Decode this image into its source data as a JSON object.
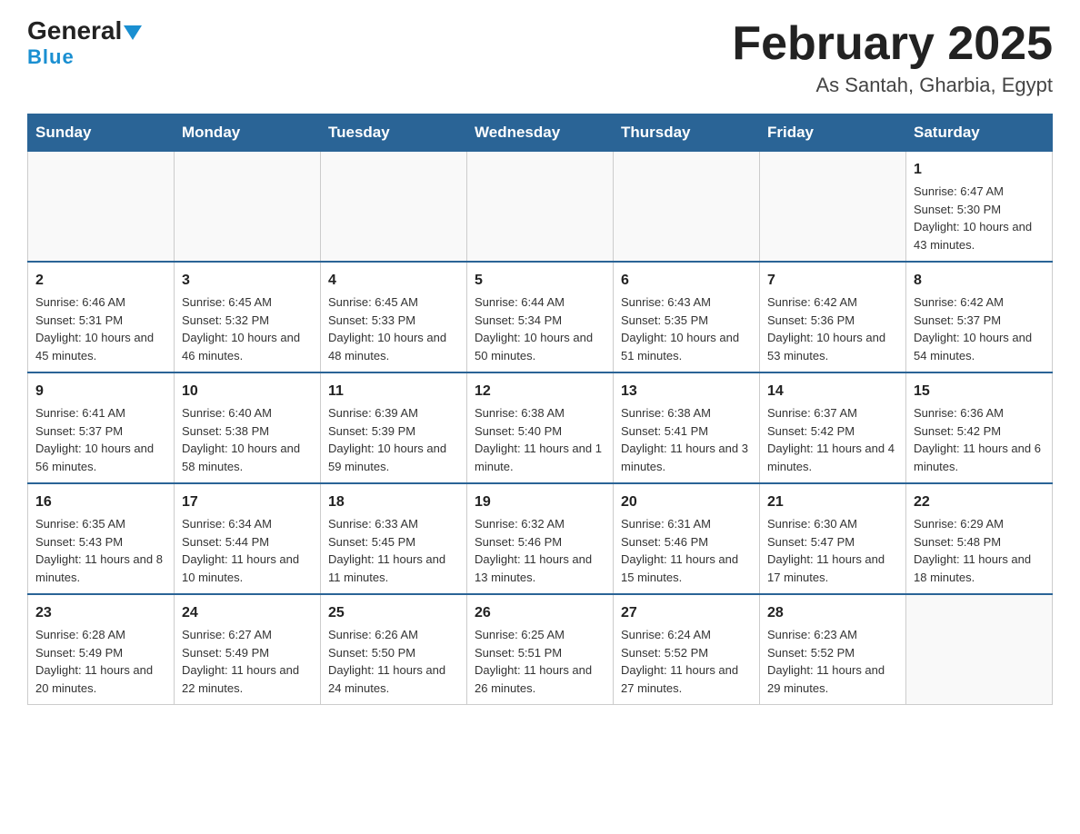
{
  "header": {
    "logo_main": "General",
    "logo_sub": "Blue",
    "title": "February 2025",
    "subtitle": "As Santah, Gharbia, Egypt"
  },
  "days_of_week": [
    "Sunday",
    "Monday",
    "Tuesday",
    "Wednesday",
    "Thursday",
    "Friday",
    "Saturday"
  ],
  "weeks": [
    [
      {
        "day": "",
        "sunrise": "",
        "sunset": "",
        "daylight": ""
      },
      {
        "day": "",
        "sunrise": "",
        "sunset": "",
        "daylight": ""
      },
      {
        "day": "",
        "sunrise": "",
        "sunset": "",
        "daylight": ""
      },
      {
        "day": "",
        "sunrise": "",
        "sunset": "",
        "daylight": ""
      },
      {
        "day": "",
        "sunrise": "",
        "sunset": "",
        "daylight": ""
      },
      {
        "day": "",
        "sunrise": "",
        "sunset": "",
        "daylight": ""
      },
      {
        "day": "1",
        "sunrise": "Sunrise: 6:47 AM",
        "sunset": "Sunset: 5:30 PM",
        "daylight": "Daylight: 10 hours and 43 minutes."
      }
    ],
    [
      {
        "day": "2",
        "sunrise": "Sunrise: 6:46 AM",
        "sunset": "Sunset: 5:31 PM",
        "daylight": "Daylight: 10 hours and 45 minutes."
      },
      {
        "day": "3",
        "sunrise": "Sunrise: 6:45 AM",
        "sunset": "Sunset: 5:32 PM",
        "daylight": "Daylight: 10 hours and 46 minutes."
      },
      {
        "day": "4",
        "sunrise": "Sunrise: 6:45 AM",
        "sunset": "Sunset: 5:33 PM",
        "daylight": "Daylight: 10 hours and 48 minutes."
      },
      {
        "day": "5",
        "sunrise": "Sunrise: 6:44 AM",
        "sunset": "Sunset: 5:34 PM",
        "daylight": "Daylight: 10 hours and 50 minutes."
      },
      {
        "day": "6",
        "sunrise": "Sunrise: 6:43 AM",
        "sunset": "Sunset: 5:35 PM",
        "daylight": "Daylight: 10 hours and 51 minutes."
      },
      {
        "day": "7",
        "sunrise": "Sunrise: 6:42 AM",
        "sunset": "Sunset: 5:36 PM",
        "daylight": "Daylight: 10 hours and 53 minutes."
      },
      {
        "day": "8",
        "sunrise": "Sunrise: 6:42 AM",
        "sunset": "Sunset: 5:37 PM",
        "daylight": "Daylight: 10 hours and 54 minutes."
      }
    ],
    [
      {
        "day": "9",
        "sunrise": "Sunrise: 6:41 AM",
        "sunset": "Sunset: 5:37 PM",
        "daylight": "Daylight: 10 hours and 56 minutes."
      },
      {
        "day": "10",
        "sunrise": "Sunrise: 6:40 AM",
        "sunset": "Sunset: 5:38 PM",
        "daylight": "Daylight: 10 hours and 58 minutes."
      },
      {
        "day": "11",
        "sunrise": "Sunrise: 6:39 AM",
        "sunset": "Sunset: 5:39 PM",
        "daylight": "Daylight: 10 hours and 59 minutes."
      },
      {
        "day": "12",
        "sunrise": "Sunrise: 6:38 AM",
        "sunset": "Sunset: 5:40 PM",
        "daylight": "Daylight: 11 hours and 1 minute."
      },
      {
        "day": "13",
        "sunrise": "Sunrise: 6:38 AM",
        "sunset": "Sunset: 5:41 PM",
        "daylight": "Daylight: 11 hours and 3 minutes."
      },
      {
        "day": "14",
        "sunrise": "Sunrise: 6:37 AM",
        "sunset": "Sunset: 5:42 PM",
        "daylight": "Daylight: 11 hours and 4 minutes."
      },
      {
        "day": "15",
        "sunrise": "Sunrise: 6:36 AM",
        "sunset": "Sunset: 5:42 PM",
        "daylight": "Daylight: 11 hours and 6 minutes."
      }
    ],
    [
      {
        "day": "16",
        "sunrise": "Sunrise: 6:35 AM",
        "sunset": "Sunset: 5:43 PM",
        "daylight": "Daylight: 11 hours and 8 minutes."
      },
      {
        "day": "17",
        "sunrise": "Sunrise: 6:34 AM",
        "sunset": "Sunset: 5:44 PM",
        "daylight": "Daylight: 11 hours and 10 minutes."
      },
      {
        "day": "18",
        "sunrise": "Sunrise: 6:33 AM",
        "sunset": "Sunset: 5:45 PM",
        "daylight": "Daylight: 11 hours and 11 minutes."
      },
      {
        "day": "19",
        "sunrise": "Sunrise: 6:32 AM",
        "sunset": "Sunset: 5:46 PM",
        "daylight": "Daylight: 11 hours and 13 minutes."
      },
      {
        "day": "20",
        "sunrise": "Sunrise: 6:31 AM",
        "sunset": "Sunset: 5:46 PM",
        "daylight": "Daylight: 11 hours and 15 minutes."
      },
      {
        "day": "21",
        "sunrise": "Sunrise: 6:30 AM",
        "sunset": "Sunset: 5:47 PM",
        "daylight": "Daylight: 11 hours and 17 minutes."
      },
      {
        "day": "22",
        "sunrise": "Sunrise: 6:29 AM",
        "sunset": "Sunset: 5:48 PM",
        "daylight": "Daylight: 11 hours and 18 minutes."
      }
    ],
    [
      {
        "day": "23",
        "sunrise": "Sunrise: 6:28 AM",
        "sunset": "Sunset: 5:49 PM",
        "daylight": "Daylight: 11 hours and 20 minutes."
      },
      {
        "day": "24",
        "sunrise": "Sunrise: 6:27 AM",
        "sunset": "Sunset: 5:49 PM",
        "daylight": "Daylight: 11 hours and 22 minutes."
      },
      {
        "day": "25",
        "sunrise": "Sunrise: 6:26 AM",
        "sunset": "Sunset: 5:50 PM",
        "daylight": "Daylight: 11 hours and 24 minutes."
      },
      {
        "day": "26",
        "sunrise": "Sunrise: 6:25 AM",
        "sunset": "Sunset: 5:51 PM",
        "daylight": "Daylight: 11 hours and 26 minutes."
      },
      {
        "day": "27",
        "sunrise": "Sunrise: 6:24 AM",
        "sunset": "Sunset: 5:52 PM",
        "daylight": "Daylight: 11 hours and 27 minutes."
      },
      {
        "day": "28",
        "sunrise": "Sunrise: 6:23 AM",
        "sunset": "Sunset: 5:52 PM",
        "daylight": "Daylight: 11 hours and 29 minutes."
      },
      {
        "day": "",
        "sunrise": "",
        "sunset": "",
        "daylight": ""
      }
    ]
  ]
}
